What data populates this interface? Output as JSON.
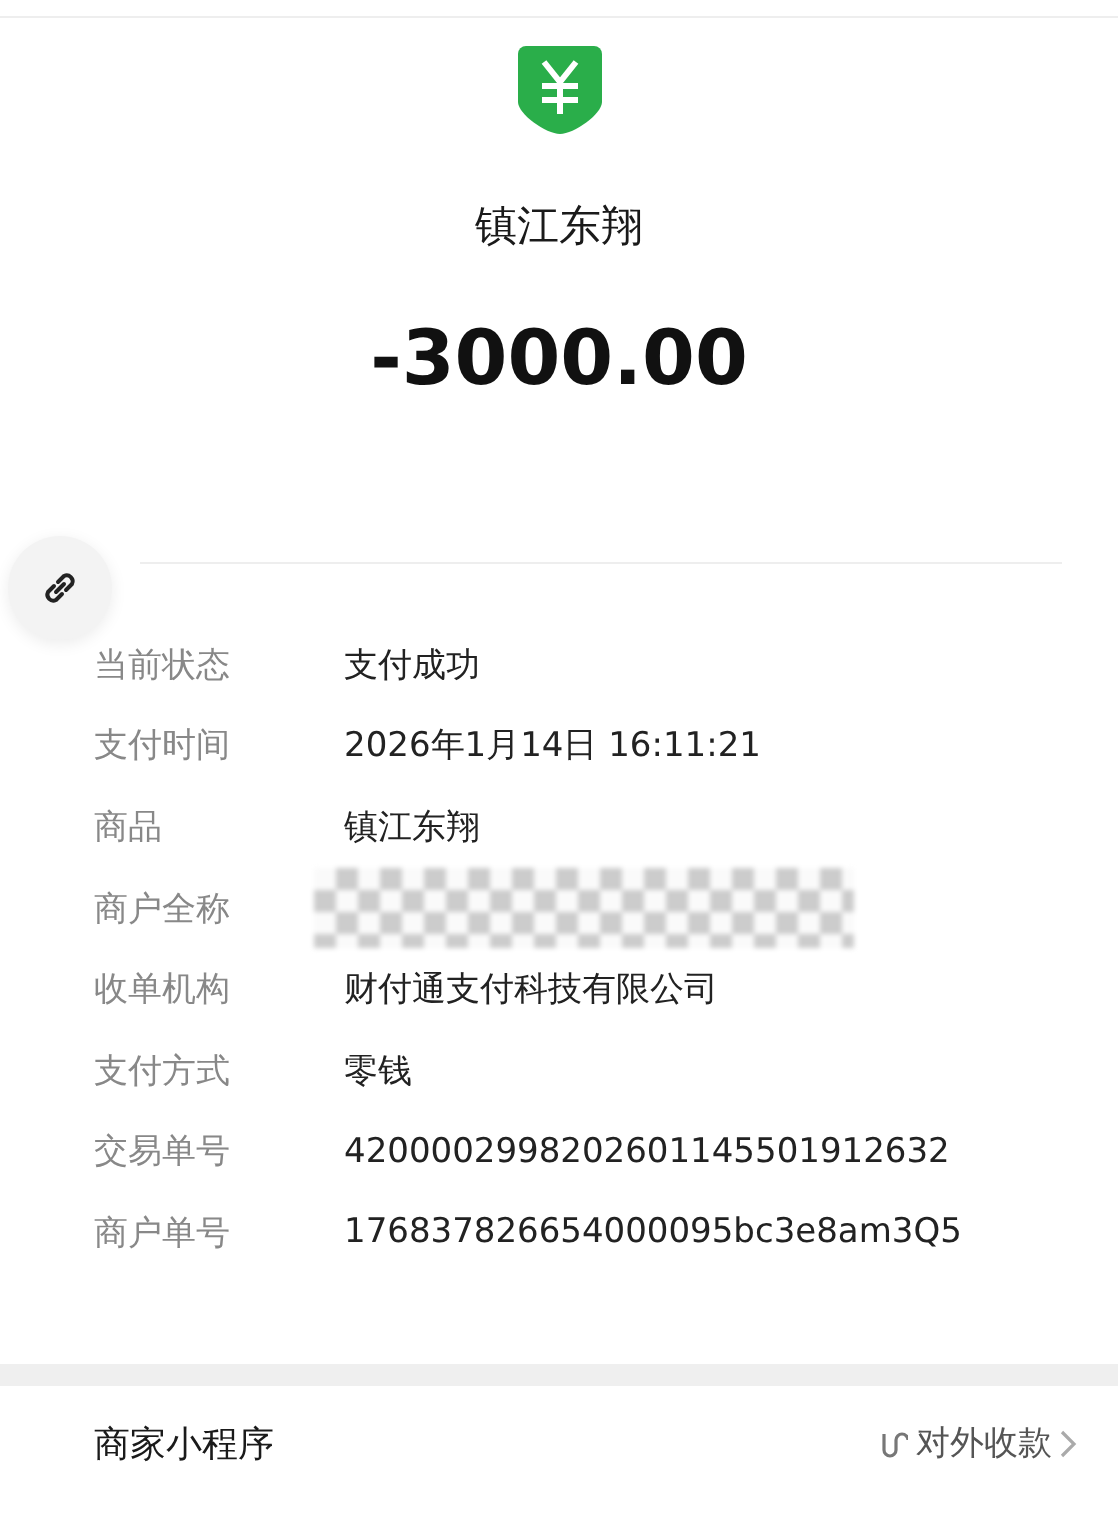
{
  "payee": "镇江东翔",
  "amount": "-3000.00",
  "details": [
    {
      "kind": "text",
      "label": "当前状态",
      "value": "支付成功"
    },
    {
      "kind": "text",
      "label": "支付时间",
      "value": "2026年1月14日 16:11:21"
    },
    {
      "kind": "text",
      "label": "商品",
      "value": "镇江东翔"
    },
    {
      "kind": "redacted",
      "label": "商户全称"
    },
    {
      "kind": "text",
      "label": "收单机构",
      "value": "财付通支付科技有限公司"
    },
    {
      "kind": "text",
      "label": "支付方式",
      "value": "零钱"
    },
    {
      "kind": "text",
      "label": "交易单号",
      "value": "4200002998202601145501912632"
    },
    {
      "kind": "text",
      "label": "商户单号",
      "value": "176837826654000095bc3e8am3Q5"
    }
  ],
  "mini_program": {
    "label": "商家小程序",
    "link": "对外收款"
  }
}
